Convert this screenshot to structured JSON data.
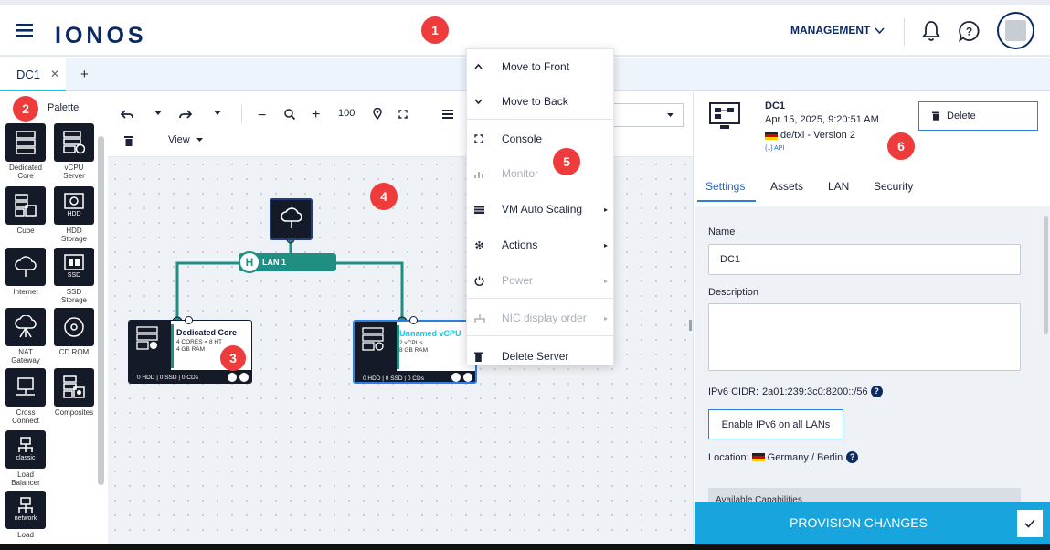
{
  "header": {
    "logo": "IONOS",
    "management_label": "MANAGEMENT",
    "icons": {
      "menu": "hamburger-icon",
      "bell": "bell-icon",
      "help": "chat-question-icon",
      "avatar": "avatar"
    }
  },
  "tabs": [
    {
      "label": "DC1"
    }
  ],
  "callouts": [
    "1",
    "2",
    "3",
    "4",
    "5",
    "6"
  ],
  "palette": {
    "title": "Palette",
    "items": [
      {
        "label": "Dedicated Core",
        "icon": "server-icon"
      },
      {
        "label": "vCPU Server",
        "icon": "vcpu-server-icon"
      },
      {
        "label": "Cube",
        "icon": "cube-icon"
      },
      {
        "label": "HDD Storage",
        "icon": "hdd-icon",
        "badge": "HDD"
      },
      {
        "label": "Internet",
        "icon": "cloud-icon"
      },
      {
        "label": "SSD Storage",
        "icon": "ssd-icon",
        "badge": "SSD"
      },
      {
        "label": "NAT Gateway",
        "icon": "nat-gateway-icon"
      },
      {
        "label": "CD ROM",
        "icon": "cdrom-icon"
      },
      {
        "label": "Cross Connect",
        "icon": "cross-connect-icon"
      },
      {
        "label": "Composites",
        "icon": "composites-icon"
      },
      {
        "label": "Load Balancer",
        "icon": "load-balancer-icon",
        "badge": "classic"
      },
      {
        "label": "Load",
        "icon": "load-balancer-icon",
        "badge": "network"
      }
    ]
  },
  "toolbar": {
    "zoom": "100",
    "view_label": "View"
  },
  "canvas": {
    "lan_label": "LAN 1",
    "lan_prefix": "H",
    "servers": [
      {
        "name": "Dedicated Core",
        "spec1": "4 CORES = 8 HT",
        "spec2": "4 GB RAM",
        "storage": "0 HDD | 0 SSD | 0 CDs"
      },
      {
        "name": "Unnamed vCPU",
        "spec1": "2 vCPUs",
        "spec2": "8 GB RAM",
        "storage": "0 HDD | 0 SSD | 0 CDs"
      }
    ]
  },
  "context_menu": {
    "items": [
      {
        "label": "Move to Front",
        "icon": "chevron-up-icon",
        "disabled": false,
        "submenu": false
      },
      {
        "label": "Move to Back",
        "icon": "chevron-down-icon",
        "disabled": false,
        "submenu": false
      },
      {
        "label": "Console",
        "icon": "console-icon",
        "disabled": false,
        "submenu": false
      },
      {
        "label": "Monitor",
        "icon": "monitor-icon",
        "disabled": true,
        "submenu": false
      },
      {
        "label": "VM Auto Scaling",
        "icon": "scaling-icon",
        "disabled": false,
        "submenu": true
      },
      {
        "label": "Actions",
        "icon": "gear-icon",
        "disabled": false,
        "submenu": true
      },
      {
        "label": "Power",
        "icon": "power-icon",
        "disabled": true,
        "submenu": true
      },
      {
        "label": "NIC display order",
        "icon": "nic-icon",
        "disabled": true,
        "submenu": true
      },
      {
        "label": "Delete Server",
        "icon": "trash-icon",
        "disabled": false,
        "submenu": false
      }
    ]
  },
  "details": {
    "title": "DC1",
    "date": "Apr 15, 2025, 9:20:51 AM",
    "location_version": "de/txl - Version 2",
    "api_label": "{..} API",
    "delete_label": "Delete",
    "tabs": [
      "Settings",
      "Assets",
      "LAN",
      "Security"
    ],
    "active_tab": "Settings",
    "name_label": "Name",
    "name_value": "DC1",
    "description_label": "Description",
    "description_value": "",
    "ipv6_label": "IPv6 CIDR:",
    "ipv6_value": "2a01:239:3c0:8200::/56",
    "enable_ipv6_label": "Enable IPv6 on all LANs",
    "location_label": "Location:",
    "location_value": "Germany / Berlin",
    "capabilities_label": "Available Capabilities",
    "provision_label": "PROVISION CHANGES"
  },
  "colors": {
    "brand": "#0b2a63",
    "accent": "#11c7e6",
    "lan": "#1f8f84",
    "provision": "#18a5dd",
    "callout": "#ee3b3b"
  }
}
